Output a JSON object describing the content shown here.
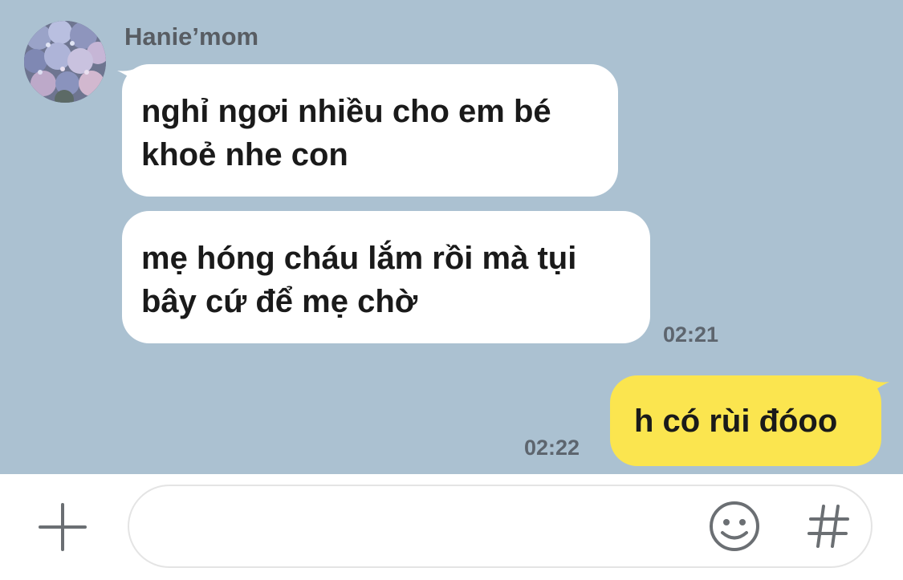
{
  "chat": {
    "background_color": "#abc1d1",
    "sender": {
      "name": "Hanie’mom",
      "avatar_icon": "hydrangea-flowers-photo"
    },
    "messages": [
      {
        "direction": "incoming",
        "lines": [
          "nghỉ ngơi nhiều cho em bé",
          "khoẻ nhe con"
        ]
      },
      {
        "direction": "incoming",
        "lines": [
          "mẹ hóng cháu lắm rồi mà tụi",
          "bây cứ để mẹ chờ"
        ],
        "time": "02:21"
      },
      {
        "direction": "outgoing",
        "lines": [
          "h có rùi đóoo"
        ],
        "time": "02:22"
      }
    ],
    "incoming_bubble_color": "#ffffff",
    "outgoing_bubble_color": "#fbe54f"
  },
  "input_bar": {
    "message_value": "",
    "plus_icon": "plus-icon",
    "emoji_icon": "smiley-face-icon",
    "hash_icon": "hash-icon"
  }
}
